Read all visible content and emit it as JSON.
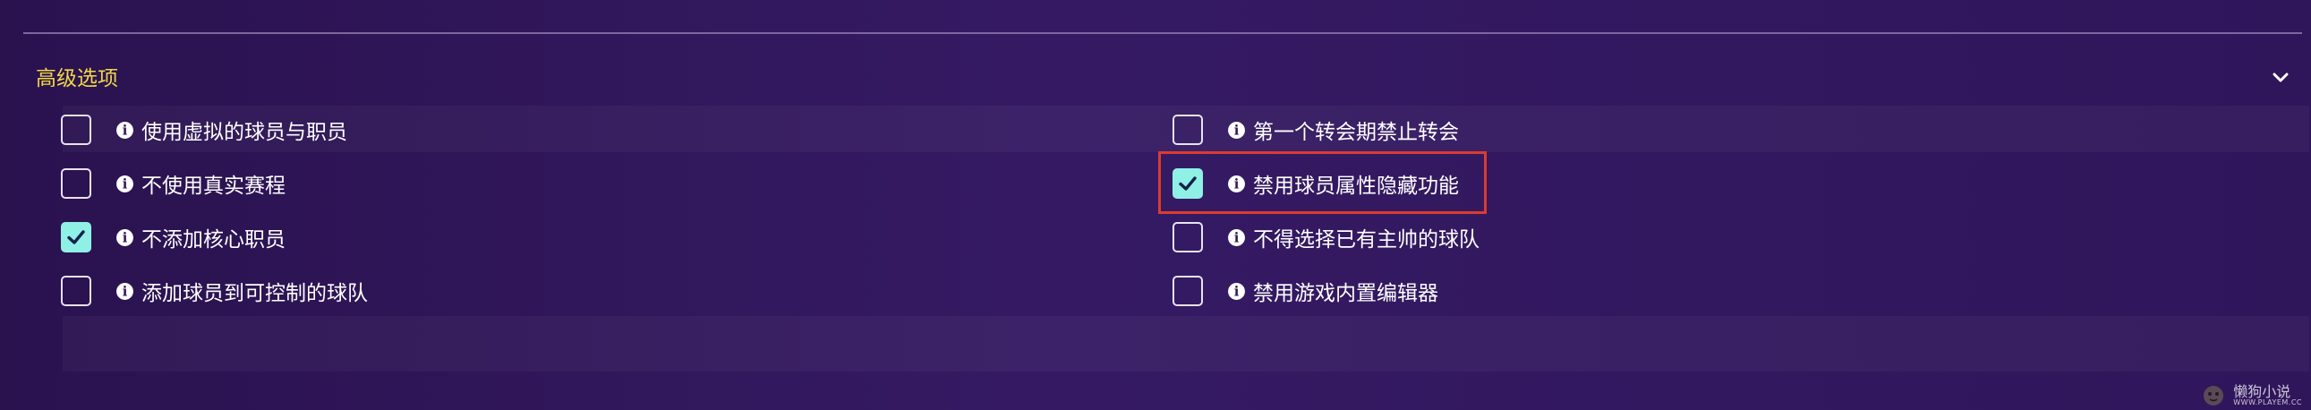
{
  "section": {
    "title": "高级选项"
  },
  "options": [
    {
      "label": "使用虚拟的球员与职员",
      "checked": false
    },
    {
      "label": "不使用真实赛程",
      "checked": false
    },
    {
      "label": "不添加核心职员",
      "checked": true
    },
    {
      "label": "添加球员到可控制的球队",
      "checked": false
    },
    {
      "label": "第一个转会期禁止转会",
      "checked": false
    },
    {
      "label": "禁用球员属性隐藏功能",
      "checked": true
    },
    {
      "label": "不得选择已有主帅的球队",
      "checked": false
    },
    {
      "label": "禁用游戏内置编辑器",
      "checked": false
    }
  ],
  "watermark": {
    "name": "懒狗小说",
    "domain": "WWW.PLAYEM.CC"
  },
  "colors": {
    "background": "#2f165b",
    "title": "#f0d844",
    "checked": "#8ff0e6",
    "highlight": "#dc3b30"
  },
  "icons": {
    "info": "info-icon",
    "chevron": "chevron-down-icon",
    "check": "check-icon"
  }
}
